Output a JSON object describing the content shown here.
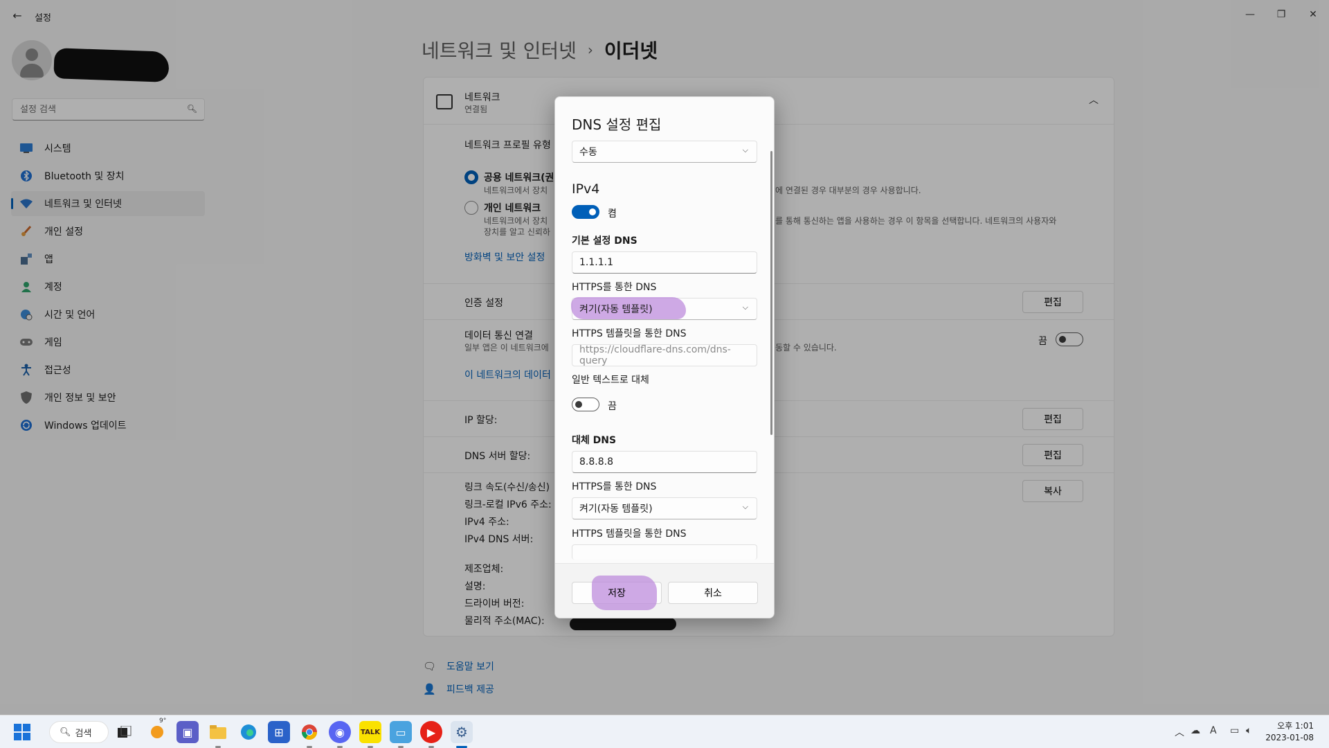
{
  "app": {
    "title": "설정",
    "back_glyph": "←",
    "minimize_glyph": "—",
    "maximize_glyph": "❐",
    "close_glyph": "✕"
  },
  "search": {
    "placeholder": "설정 검색"
  },
  "nav": {
    "items": [
      {
        "label": "시스템",
        "icon": "display-icon"
      },
      {
        "label": "Bluetooth 및 장치",
        "icon": "bluetooth-icon"
      },
      {
        "label": "네트워크 및 인터넷",
        "icon": "wifi-icon",
        "active": true
      },
      {
        "label": "개인 설정",
        "icon": "brush-icon"
      },
      {
        "label": "앱",
        "icon": "apps-icon"
      },
      {
        "label": "계정",
        "icon": "person-icon"
      },
      {
        "label": "시간 및 언어",
        "icon": "globe-clock-icon"
      },
      {
        "label": "게임",
        "icon": "gamepad-icon"
      },
      {
        "label": "접근성",
        "icon": "accessibility-icon"
      },
      {
        "label": "개인 정보 및 보안",
        "icon": "shield-icon"
      },
      {
        "label": "Windows 업데이트",
        "icon": "update-icon"
      }
    ]
  },
  "breadcrumb": {
    "parent": "네트워크 및 인터넷",
    "separator": "›",
    "current": "이더넷"
  },
  "network_card": {
    "title": "네트워크",
    "status": "연결됨",
    "profile_type_label": "네트워크 프로필 유형",
    "public": {
      "label": "공용 네트워크(권",
      "desc_left": "네트워크에서 장치",
      "desc_right": "에 연결된 경우 대부분의 경우 사용합니다."
    },
    "private": {
      "label": "개인 네트워크",
      "desc_left": "네트워크에서 장치",
      "desc_right": "를 통해 통신하는 앱을 사용하는 경우 이 항목을 선택합니다. 네트워크의 사용자와",
      "desc_line2": "장치를 알고 신뢰하"
    },
    "firewall_link": "방화벽 및 보안 설정",
    "auth_label": "인증 설정",
    "metered_label": "데이터 통신 연결",
    "metered_desc_left": "일부 앱은 이 네트워크에",
    "metered_desc_right": "동할 수 있습니다.",
    "metered_state": "끔",
    "data_limit_link": "이 네트워크의 데이터",
    "ip_label": "IP 할당:",
    "dns_label": "DNS 서버 할당:",
    "link_speed": "링크 속도(수신/송신)",
    "ipv6_local": "링크-로컬 IPv6 주소:",
    "ipv4": "IPv4 주소:",
    "ipv4_dns": "IPv4 DNS 서버:",
    "manufacturer": "제조업체:",
    "description": "설명:",
    "driver": "드라이버 버전:",
    "mac": "물리적 주소(MAC):",
    "edit": "편집",
    "copy": "복사"
  },
  "help": {
    "get_help": "도움말 보기",
    "feedback": "피드백 제공"
  },
  "dialog": {
    "title": "DNS 설정 편집",
    "mode": "수동",
    "ipv4_heading": "IPv4",
    "ipv4_toggle_state": "켬",
    "preferred_label": "기본 설정 DNS",
    "preferred_value": "1.1.1.1",
    "doh_label": "HTTPS를 통한 DNS",
    "doh_value": "켜기(자동 템플릿)",
    "doh_template_label": "HTTPS 템플릿을 통한 DNS",
    "doh_template_placeholder": "https://cloudflare-dns.com/dns-query",
    "fallback_label": "일반 텍스트로 대체",
    "fallback_state": "끔",
    "alternate_label": "대체 DNS",
    "alternate_value": "8.8.8.8",
    "doh_label_2": "HTTPS를 통한 DNS",
    "doh_value_2": "켜기(자동 템플릿)",
    "doh_template_label_2": "HTTPS 템플릿을 통한 DNS",
    "save": "저장",
    "cancel": "취소",
    "chevron": "⌵"
  },
  "taskbar": {
    "search_label": "검색",
    "weather_badge": "9°",
    "clock_period_time": "오후 1:01",
    "clock_date": "2023-01-08"
  },
  "colors": {
    "accent": "#005fb8",
    "highlight": "#be8cdc"
  }
}
